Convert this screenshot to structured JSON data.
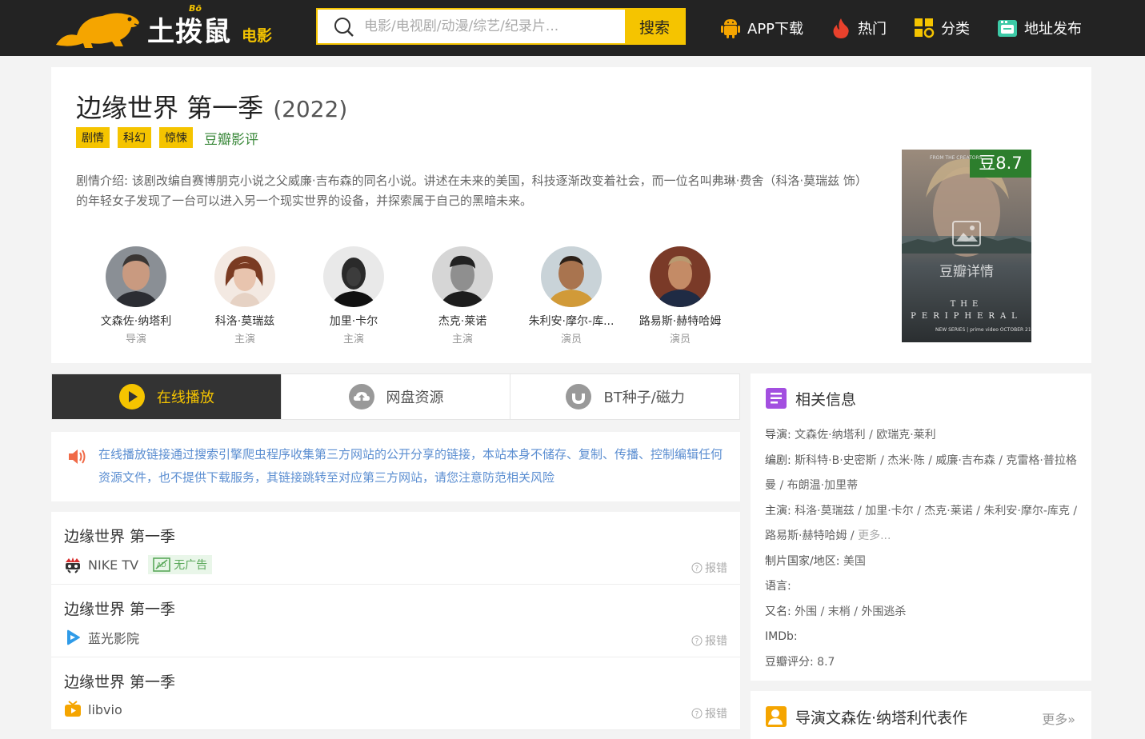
{
  "header": {
    "logo_text": "土拨鼠",
    "logo_sub": "电影",
    "logo_bo": "Bō",
    "search_placeholder": "电影/电视剧/动漫/综艺/纪录片...",
    "search_button": "搜索",
    "nav": [
      {
        "label": "APP下载",
        "icon": "android-icon"
      },
      {
        "label": "热门",
        "icon": "fire-icon"
      },
      {
        "label": "分类",
        "icon": "category-icon"
      },
      {
        "label": "地址发布",
        "icon": "address-icon"
      }
    ]
  },
  "movie": {
    "title": "边缘世界 第一季",
    "year": "(2022)",
    "tags": [
      "剧情",
      "科幻",
      "惊悚"
    ],
    "douban_review": "豆瓣影评",
    "intro": "剧情介绍: 该剧改编自赛博朋克小说之父威廉·吉布森的同名小说。讲述在未来的美国，科技逐渐改变着社会，而一位名叫弗琳·费舍（科洛·莫瑞兹 饰）的年轻女子发现了一台可以进入另一个现实世界的设备，并探索属于自己的黑暗未来。",
    "poster_score": "豆8.7",
    "poster_link": "豆瓣详情",
    "poster_top": "FROM THE CREATORS",
    "poster_t1": "THE",
    "poster_t2": "PERIPHERAL",
    "poster_bottom": "NEW SERIES | prime video OCTOBER 21",
    "cast": [
      {
        "name": "文森佐·纳塔利",
        "role": "导演"
      },
      {
        "name": "科洛·莫瑞兹",
        "role": "主演"
      },
      {
        "name": "加里·卡尔",
        "role": "主演"
      },
      {
        "name": "杰克·莱诺",
        "role": "主演"
      },
      {
        "name": "朱利安·摩尔-库...",
        "role": "演员"
      },
      {
        "name": "路易斯·赫特哈姆",
        "role": "演员"
      }
    ]
  },
  "play_tabs": [
    {
      "label": "在线播放",
      "icon": "play-icon",
      "active": true
    },
    {
      "label": "网盘资源",
      "icon": "cloud-upload-icon",
      "active": false
    },
    {
      "label": "BT种子/磁力",
      "icon": "magnet-icon",
      "active": false
    }
  ],
  "notice": "在线播放链接通过搜索引擎爬虫程序收集第三方网站的公开分享的链接，本站本身不储存、复制、传播、控制编辑任何资源文件，也不提供下载服务，其链接跳转至对应第三方网站，请您注意防范相关风险",
  "sources": [
    {
      "title": "边缘世界 第一季",
      "site": "NIKE TV",
      "no_ad": "无广告",
      "report": "报错"
    },
    {
      "title": "边缘世界 第一季",
      "site": "蓝光影院",
      "report": "报错"
    },
    {
      "title": "边缘世界 第一季",
      "site": "libvio",
      "report": "报错"
    }
  ],
  "related": {
    "heading": "相关信息",
    "items": [
      {
        "key": "导演:",
        "value": " 文森佐·纳塔利 / 欧瑞克·莱利"
      },
      {
        "key": "编剧:",
        "value": " 斯科特·B·史密斯 / 杰米·陈 / 威廉·吉布森 / 克雷格·普拉格曼 / 布朗温·加里蒂"
      },
      {
        "key": "主演:",
        "value": " 科洛·莫瑞兹 / 加里·卡尔 / 杰克·莱诺 / 朱利安·摩尔-库克 / 路易斯·赫特哈姆 / ",
        "more": "更多..."
      },
      {
        "key": "制片国家/地区:",
        "value": " 美国"
      },
      {
        "key": "语言:",
        "value": ""
      },
      {
        "key": "又名:",
        "value": " 外围 / 末梢 / 外围逃杀"
      },
      {
        "key": "IMDb:",
        "value": ""
      },
      {
        "key": "豆瓣评分:",
        "value": " 8.7"
      }
    ]
  },
  "works": {
    "heading": "导演文森佐·纳塔利代表作",
    "more": "更多»"
  }
}
